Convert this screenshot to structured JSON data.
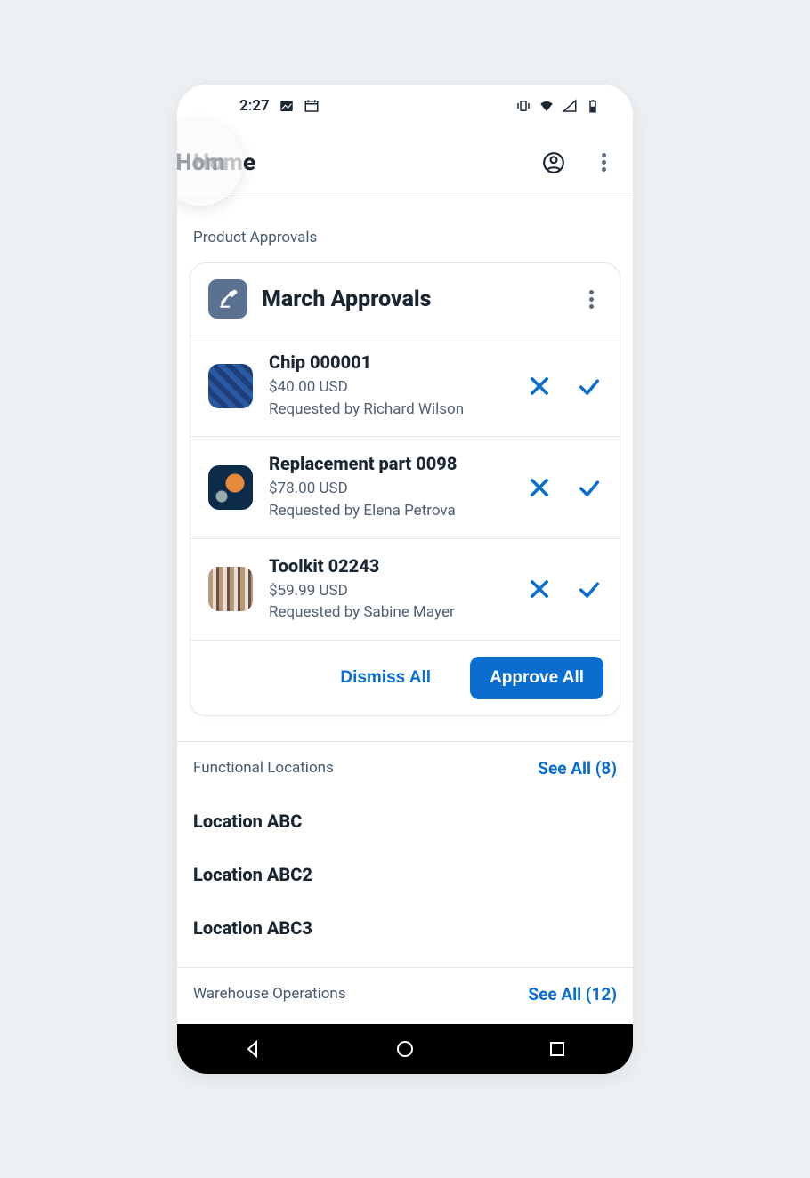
{
  "status": {
    "time": "2:27"
  },
  "appbar": {
    "title": "Home"
  },
  "sections": {
    "approvals_label": "Product Approvals",
    "locations_label": "Functional Locations",
    "locations_see_all": "See All (8)",
    "warehouse_label": "Warehouse Operations",
    "warehouse_see_all": "See All (12)"
  },
  "approvals_card": {
    "title": "March Approvals",
    "dismiss_all": "Dismiss All",
    "approve_all": "Approve All",
    "items": [
      {
        "title": "Chip 000001",
        "price": "$40.00 USD",
        "requester": "Requested by Richard Wilson"
      },
      {
        "title": "Replacement part 0098",
        "price": "$78.00 USD",
        "requester": "Requested by Elena Petrova"
      },
      {
        "title": "Toolkit 02243",
        "price": "$59.99 USD",
        "requester": "Requested by Sabine Mayer"
      }
    ]
  },
  "locations": [
    {
      "name": "Location ABC"
    },
    {
      "name": "Location ABC2"
    },
    {
      "name": "Location ABC3"
    }
  ]
}
